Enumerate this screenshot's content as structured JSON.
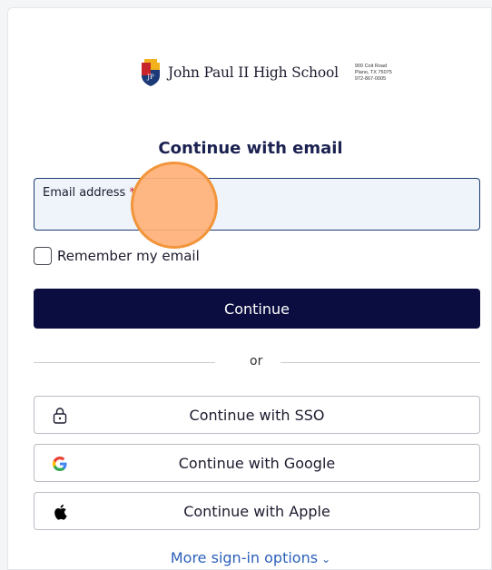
{
  "header": {
    "school_name": "John Paul II High School",
    "address_line1": "900 Coit Road",
    "address_line2": "Plano, TX 75075",
    "address_line3": "972-867-0005"
  },
  "form": {
    "heading": "Continue with email",
    "email_label": "Email address",
    "required_mark": "*",
    "email_value": "",
    "remember_label": "Remember my email",
    "remember_checked": false,
    "continue_label": "Continue",
    "divider_text": "or"
  },
  "alt_signin": [
    {
      "label": "Continue with SSO",
      "icon": "lock-icon"
    },
    {
      "label": "Continue with Google",
      "icon": "google-icon"
    },
    {
      "label": "Continue with Apple",
      "icon": "apple-icon"
    }
  ],
  "more_options": {
    "label": "More sign-in options",
    "icon": "chevron-down-icon"
  },
  "colors": {
    "primary_button": "#0b0c3f",
    "heading": "#1b2150",
    "link": "#2b5fb8",
    "input_border": "#1b3c72",
    "touch_indicator": "#f2953a"
  }
}
